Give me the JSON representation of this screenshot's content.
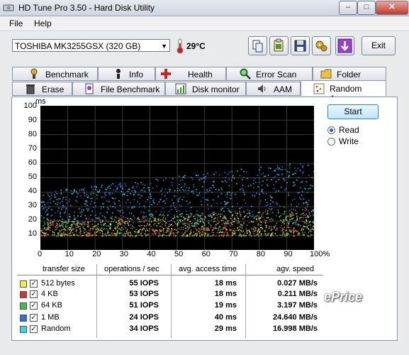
{
  "window": {
    "title": "HD Tune Pro 3.50 - Hard Disk Utility"
  },
  "menu": {
    "file": "File",
    "help": "Help"
  },
  "drive": {
    "selected": "TOSHIBA MK3255GSX (320 GB)",
    "temperature": "29°C"
  },
  "toolbar": {
    "exit_label": "Exit"
  },
  "tabs_row1": [
    "Benchmark",
    "Info",
    "Health",
    "Error Scan",
    "Folder Usage"
  ],
  "tabs_row2": [
    "Erase",
    "File Benchmark",
    "Disk monitor",
    "AAM",
    "Random Access"
  ],
  "active_tab": "Random Access",
  "controls": {
    "start_label": "Start",
    "read_label": "Read",
    "write_label": "Write",
    "selected_mode": "Read"
  },
  "chart_data": {
    "type": "scatter",
    "ylabel": "ms",
    "ylim": [
      0,
      100
    ],
    "xlim": [
      0,
      100
    ],
    "y_ticks": [
      "100",
      "90",
      "80",
      "70",
      "60",
      "50",
      "40",
      "30",
      "20",
      "10"
    ],
    "x_ticks": [
      "0",
      "10",
      "20",
      "30",
      "40",
      "50",
      "60",
      "70",
      "80",
      "90",
      "100%"
    ],
    "series": [
      {
        "name": "512 bytes",
        "color": "#e8e23a",
        "y_range": [
          10,
          28
        ]
      },
      {
        "name": "4 KB",
        "color": "#d8322e",
        "y_range": [
          10,
          30
        ]
      },
      {
        "name": "64 KB",
        "color": "#3fbf3f",
        "y_range": [
          10,
          30
        ]
      },
      {
        "name": "1 MB",
        "color": "#2f6fd0",
        "y_range": [
          15,
          62
        ]
      },
      {
        "name": "Random",
        "color": "#2fc0d0",
        "y_range": [
          15,
          62
        ]
      }
    ]
  },
  "results": {
    "headers": [
      "transfer size",
      "operations / sec",
      "avg. access time",
      "agv. speed"
    ],
    "rows": [
      {
        "size": "512 bytes",
        "ops": "55 IOPS",
        "access": "18 ms",
        "speed": "0.027 MB/s",
        "color": "#f3ef3c"
      },
      {
        "size": "4 KB",
        "ops": "53 IOPS",
        "access": "18 ms",
        "speed": "0.211 MB/s",
        "color": "#d8322e"
      },
      {
        "size": "64 KB",
        "ops": "51 IOPS",
        "access": "19 ms",
        "speed": "3.197 MB/s",
        "color": "#3fbf3f"
      },
      {
        "size": "1 MB",
        "ops": "24 IOPS",
        "access": "40 ms",
        "speed": "24.640 MB/s",
        "color": "#2f6fd0"
      },
      {
        "size": "Random",
        "ops": "34 IOPS",
        "access": "29 ms",
        "speed": "16.998 MB/s",
        "color": "#39d6e6"
      }
    ]
  },
  "watermark": "ePrice"
}
